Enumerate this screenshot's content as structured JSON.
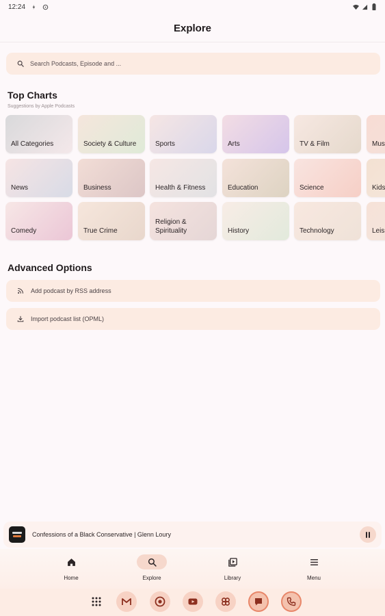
{
  "status_bar": {
    "time": "12:24"
  },
  "header": {
    "title": "Explore"
  },
  "search": {
    "placeholder": "Search Podcasts, Episode and ..."
  },
  "top_charts": {
    "title": "Top Charts",
    "subtitle": "Suggestions by Apple Podcasts",
    "rows": [
      [
        "All Categories",
        "Society & Culture",
        "Sports",
        "Arts",
        "TV & Film",
        "Music"
      ],
      [
        "News",
        "Business",
        "Health & Fitness",
        "Education",
        "Science",
        "Kids & Family"
      ],
      [
        "Comedy",
        "True Crime",
        "Religion & Spirituality",
        "History",
        "Technology",
        "Leisure"
      ]
    ]
  },
  "advanced_options": {
    "title": "Advanced Options",
    "items": [
      "Add podcast by RSS address",
      "Import podcast list (OPML)"
    ]
  },
  "mini_player": {
    "title": "Confessions of a Black Conservative | Glenn Loury"
  },
  "bottom_nav": {
    "items": [
      {
        "label": "Home",
        "icon": "home-icon",
        "active": false
      },
      {
        "label": "Explore",
        "icon": "search-icon",
        "active": true
      },
      {
        "label": "Library",
        "icon": "library-icon",
        "active": false
      },
      {
        "label": "Menu",
        "icon": "menu-icon",
        "active": false
      }
    ]
  },
  "dock": {
    "icons": [
      "apps-grid-icon",
      "gmail-icon",
      "chrome-icon",
      "youtube-icon",
      "photos-icon",
      "messages-icon",
      "phone-icon"
    ]
  },
  "colors": {
    "accent_surface": "#fcebe2",
    "active_pill": "#f6d8cc",
    "background": "#fdf8fa"
  }
}
